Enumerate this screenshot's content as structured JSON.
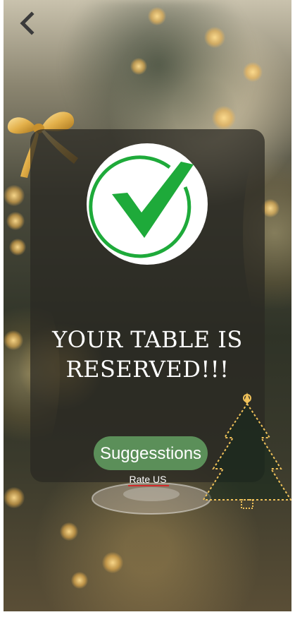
{
  "header": {
    "back_icon": "chevron-left-icon"
  },
  "decorations": {
    "bow_icon": "gold-ribbon-bow-icon",
    "tree_icon": "sparkle-christmas-tree-icon",
    "glass_icon": "glass-plate-icon",
    "accent_gold": "#f0c25a"
  },
  "confirmation": {
    "status_icon": "checkmark-circle-icon",
    "check_color": "#1eaa3a",
    "headline_line1": "YOUR TABLE IS",
    "headline_line2": "RESERVED!!!"
  },
  "actions": {
    "suggestions_label": "Suggesstions",
    "suggestions_color": "#5b8f59",
    "rate_label": "Rate US",
    "rate_underline_color": "#d22a2a"
  }
}
